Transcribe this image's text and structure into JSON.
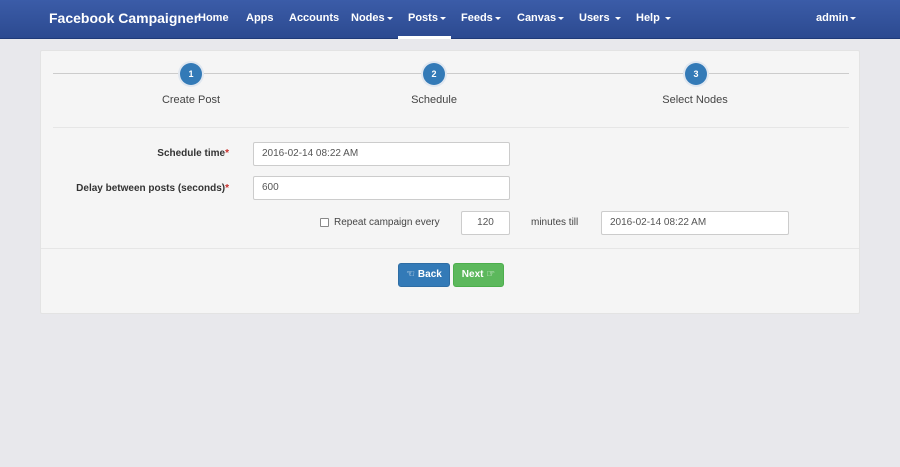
{
  "navbar": {
    "brand": "Facebook Campaigner",
    "items": [
      {
        "label": "Home",
        "dropdown": false
      },
      {
        "label": "Apps",
        "dropdown": false
      },
      {
        "label": "Accounts",
        "dropdown": false
      },
      {
        "label": "Nodes",
        "dropdown": true
      },
      {
        "label": "Posts",
        "dropdown": true,
        "active": true
      },
      {
        "label": "Feeds",
        "dropdown": true
      },
      {
        "label": "Canvas",
        "dropdown": true
      },
      {
        "label": "Users",
        "dropdown": true
      },
      {
        "label": "Help",
        "dropdown": true
      }
    ],
    "user": "admin"
  },
  "wizard": {
    "steps": [
      {
        "number": "1",
        "label": "Create Post"
      },
      {
        "number": "2",
        "label": "Schedule"
      },
      {
        "number": "3",
        "label": "Select Nodes"
      }
    ]
  },
  "form": {
    "schedule_time_label": "Schedule time",
    "schedule_time_value": "2016-02-14 08:22 AM",
    "delay_label": "Delay between posts (seconds)",
    "delay_value": "600",
    "required_mark": "*",
    "repeat_label": "Repeat campaign every",
    "repeat_value": "120",
    "minutes_till_label": "minutes till",
    "till_value": "2016-02-14 08:22 AM"
  },
  "buttons": {
    "back_label": "Back",
    "next_label": "Next"
  },
  "colors": {
    "navbar": "#3b5ca8",
    "step": "#337ab7",
    "back_button": "#337ab7",
    "next_button": "#5cb85c"
  }
}
